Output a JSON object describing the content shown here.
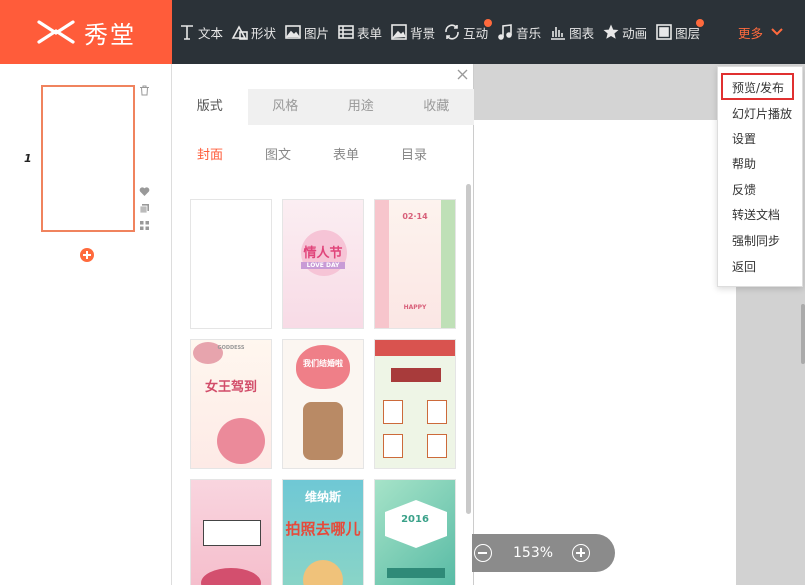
{
  "app": {
    "logo_text": "秀堂"
  },
  "toolbar": {
    "items": [
      {
        "label": "文本",
        "icon": "text-icon",
        "dot": false
      },
      {
        "label": "形状",
        "icon": "shape-icon",
        "dot": false
      },
      {
        "label": "图片",
        "icon": "image-icon",
        "dot": false
      },
      {
        "label": "表单",
        "icon": "form-icon",
        "dot": false
      },
      {
        "label": "背景",
        "icon": "background-icon",
        "dot": false
      },
      {
        "label": "互动",
        "icon": "interact-icon",
        "dot": true
      },
      {
        "label": "音乐",
        "icon": "music-icon",
        "dot": false
      },
      {
        "label": "图表",
        "icon": "chart-icon",
        "dot": false
      },
      {
        "label": "动画",
        "icon": "star-icon",
        "dot": false
      },
      {
        "label": "图层",
        "icon": "layer-icon",
        "dot": true
      }
    ],
    "more_label": "更多",
    "accent": "#ff6a3d"
  },
  "pages": {
    "current_number": "1"
  },
  "templates": {
    "tabs": [
      "版式",
      "风格",
      "用途",
      "收藏"
    ],
    "active_tab": 0,
    "subtabs": [
      "封面",
      "图文",
      "表单",
      "目录"
    ],
    "active_subtab": 0,
    "cards": [
      {
        "title": ""
      },
      {
        "title": "情人节",
        "sub": "LOVE DAY"
      },
      {
        "title": "02·14",
        "sub": "HAPPY"
      },
      {
        "title": "女王驾到",
        "sub": "GODDESS"
      },
      {
        "title": "我们结婚啦",
        "sub": ""
      },
      {
        "title": "",
        "sub": ""
      },
      {
        "title": "",
        "sub": ""
      },
      {
        "title": "维纳斯",
        "sub": "拍照去哪儿"
      },
      {
        "title": "2016",
        "sub": ""
      }
    ]
  },
  "zoom": {
    "value": "153%"
  },
  "more_menu": {
    "items": [
      "预览/发布",
      "幻灯片播放",
      "设置",
      "帮助",
      "反馈",
      "转送文档",
      "强制同步",
      "返回"
    ],
    "highlighted": 0
  }
}
